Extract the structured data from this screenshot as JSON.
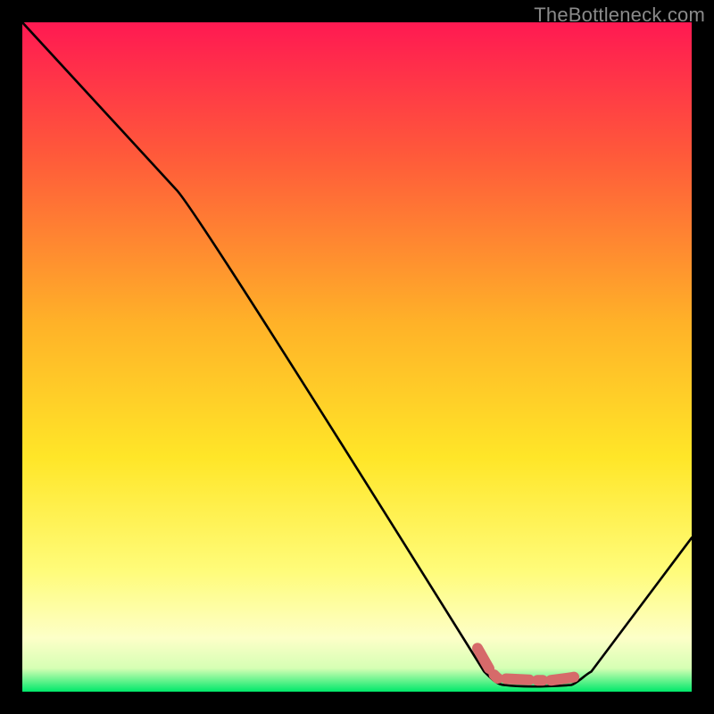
{
  "watermark": "TheBottleneck.com",
  "chart_data": {
    "type": "line",
    "title": "",
    "xlabel": "",
    "ylabel": "",
    "xlim": [
      0,
      100
    ],
    "ylim": [
      0,
      100
    ],
    "gradient_stops": [
      {
        "offset": 0.0,
        "color": "#ff1952"
      },
      {
        "offset": 0.2,
        "color": "#ff5a3a"
      },
      {
        "offset": 0.45,
        "color": "#ffb228"
      },
      {
        "offset": 0.65,
        "color": "#ffe628"
      },
      {
        "offset": 0.82,
        "color": "#fffc7a"
      },
      {
        "offset": 0.92,
        "color": "#fdffc8"
      },
      {
        "offset": 0.965,
        "color": "#d6ffb4"
      },
      {
        "offset": 1.0,
        "color": "#00e86a"
      }
    ],
    "series": [
      {
        "name": "bottleneck-curve",
        "points": [
          {
            "x": 0,
            "y": 100
          },
          {
            "x": 23,
            "y": 75
          },
          {
            "x": 69,
            "y": 3
          },
          {
            "x": 72,
            "y": 1
          },
          {
            "x": 82,
            "y": 1
          },
          {
            "x": 85,
            "y": 3
          },
          {
            "x": 100,
            "y": 23
          }
        ]
      }
    ],
    "highlight": {
      "label": "optimal-range",
      "color": "#d66a6a",
      "points": [
        {
          "x": 68,
          "y": 6.5
        },
        {
          "x": 70,
          "y": 3
        },
        {
          "x": 71,
          "y": 2
        },
        {
          "x": 77,
          "y": 1.7
        },
        {
          "x": 79,
          "y": 1.7
        },
        {
          "x": 82,
          "y": 2.1
        },
        {
          "x": 83,
          "y": 2.3
        }
      ]
    }
  }
}
